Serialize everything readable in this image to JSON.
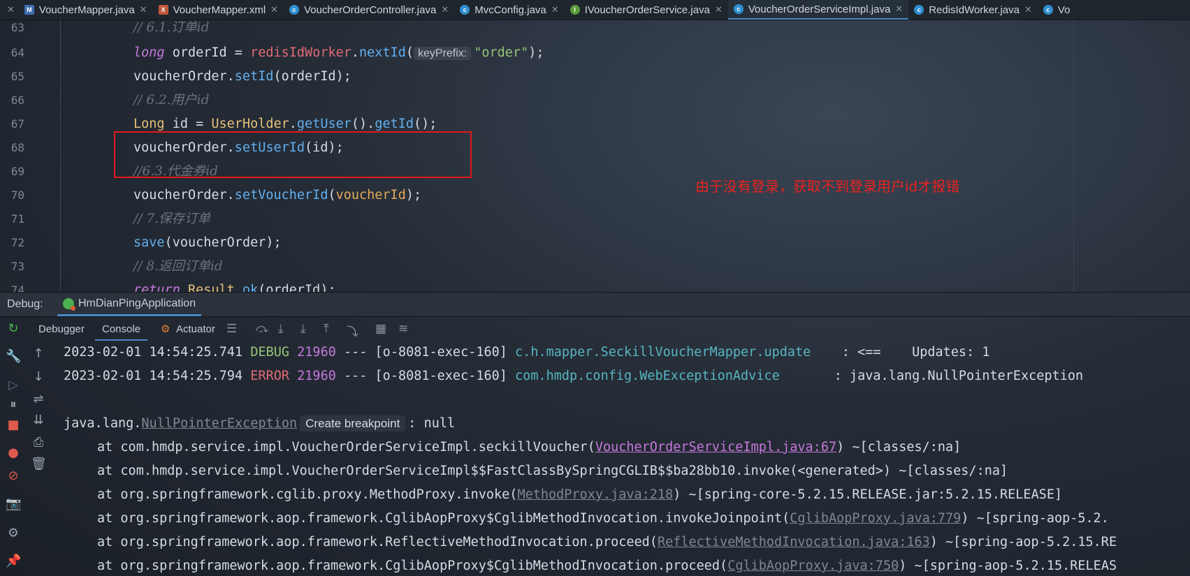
{
  "tabs": [
    {
      "label": "VoucherMapper.java",
      "icon": "mapper-java-icon",
      "active": false
    },
    {
      "label": "VoucherMapper.xml",
      "icon": "mapper-xml-icon",
      "active": false
    },
    {
      "label": "VoucherOrderController.java",
      "icon": "class-icon",
      "active": false
    },
    {
      "label": "MvcConfig.java",
      "icon": "class-icon",
      "active": false
    },
    {
      "label": "IVoucherOrderService.java",
      "icon": "interface-icon",
      "active": false
    },
    {
      "label": "VoucherOrderServiceImpl.java",
      "icon": "class-icon",
      "active": true
    },
    {
      "label": "RedisIdWorker.java",
      "icon": "class-icon",
      "active": false
    },
    {
      "label": "Vo",
      "icon": "class-icon",
      "active": false
    }
  ],
  "editor": {
    "line_numbers": [
      "63",
      "64",
      "65",
      "66",
      "67",
      "68",
      "69",
      "70",
      "71",
      "72",
      "73",
      "74"
    ],
    "code": {
      "l63_comment": "// 6.1.订单id",
      "l64_kw": "long",
      "l64_var": " orderId = ",
      "l64_field": "redisIdWorker",
      "l64_dot": ".",
      "l64_method": "nextId",
      "l64_open": "(",
      "l64_hint": "keyPrefix:",
      "l64_str": "\"order\"",
      "l64_close": ");",
      "l65_obj": "voucherOrder.",
      "l65_method": "setId",
      "l65_args": "(orderId);",
      "l66_comment": "// 6.2.用户id",
      "l67_type": "Long",
      "l67_mid": " id = ",
      "l67_cls": "UserHolder",
      "l67_dot1": ".",
      "l67_m1": "getUser",
      "l67_paren": "().",
      "l67_m2": "getId",
      "l67_end": "();",
      "l68_obj": "voucherOrder.",
      "l68_method": "setUserId",
      "l68_args": "(id);",
      "l69_comment": "//6.3.代金券id",
      "l70_obj": "voucherOrder.",
      "l70_method": "setVoucherId",
      "l70_open": "(",
      "l70_param": "voucherId",
      "l70_close": ");",
      "l71_comment": "// 7.保存订单",
      "l72_method": "save",
      "l72_args": "(voucherOrder);",
      "l73_comment": "// 8.返回订单id",
      "l74_kw": "return",
      "l74_sp": " ",
      "l74_cls": "Result",
      "l74_dot": ".",
      "l74_method": "ok",
      "l74_args": "(orderId);"
    }
  },
  "annotation": "由于没有登录，获取不到登录用户id才报错",
  "debug": {
    "label": "Debug:",
    "app": "HmDianPingApplication",
    "tabs": [
      "Debugger",
      "Console",
      "Actuator"
    ],
    "active_tab": "Console"
  },
  "console": {
    "line1": {
      "ts": "2023-02-01 14:54:25.741 ",
      "level": "DEBUG",
      "sp": " ",
      "pid": "21960",
      "mid": " --- [o-8081-exec-160] ",
      "logger": "c.h.mapper.SeckillVoucherMapper.update",
      "msg": "    : <==    Updates: 1"
    },
    "line2": {
      "ts": "2023-02-01 14:54:25.794 ",
      "level": "ERROR",
      "sp": " ",
      "pid": "21960",
      "mid": " --- [o-8081-exec-160] ",
      "logger": "com.hmdp.config.WebExceptionAdvice",
      "msg": "       : java.lang.NullPointerException"
    },
    "exc": {
      "prefix": "java.lang.",
      "name": "NullPointerException",
      "breakpoint": "Create breakpoint",
      "suffix": ": null"
    },
    "trace": [
      {
        "pre": "at com.hmdp.service.impl.VoucherOrderServiceImpl.seckillVoucher(",
        "link": "VoucherOrderServiceImpl.java:67",
        "post": ") ~[classes/:na]",
        "style": "purple"
      },
      {
        "pre": "at com.hmdp.service.impl.VoucherOrderServiceImpl$$FastClassBySpringCGLIB$$ba28bb10.invoke(<generated>) ~[classes/:na]",
        "link": "",
        "post": "",
        "style": "none"
      },
      {
        "pre": "at org.springframework.cglib.proxy.MethodProxy.invoke(",
        "link": "MethodProxy.java:218",
        "post": ") ~[spring-core-5.2.15.RELEASE.jar:5.2.15.RELEASE]",
        "style": "grey"
      },
      {
        "pre": "at org.springframework.aop.framework.CglibAopProxy$CglibMethodInvocation.invokeJoinpoint(",
        "link": "CglibAopProxy.java:779",
        "post": ") ~[spring-aop-5.2.",
        "style": "grey"
      },
      {
        "pre": "at org.springframework.aop.framework.ReflectiveMethodInvocation.proceed(",
        "link": "ReflectiveMethodInvocation.java:163",
        "post": ") ~[spring-aop-5.2.15.RE",
        "style": "grey"
      },
      {
        "pre": "at org.springframework.aop.framework.CglibAopProxy$CglibMethodInvocation.proceed(",
        "link": "CglibAopProxy.java:750",
        "post": ") ~[spring-aop-5.2.15.RELEAS",
        "style": "grey"
      }
    ]
  }
}
